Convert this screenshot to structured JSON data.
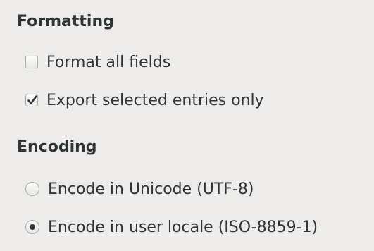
{
  "formatting": {
    "title": "Formatting",
    "options": [
      {
        "label": "Format all fields",
        "checked": false
      },
      {
        "label": "Export selected entries only",
        "checked": true
      }
    ]
  },
  "encoding": {
    "title": "Encoding",
    "options": [
      {
        "label": "Encode in Unicode (UTF-8)",
        "selected": false
      },
      {
        "label": "Encode in user locale (ISO-8859-1)",
        "selected": true
      }
    ]
  },
  "icons": {
    "checked_mark": "check-icon"
  }
}
